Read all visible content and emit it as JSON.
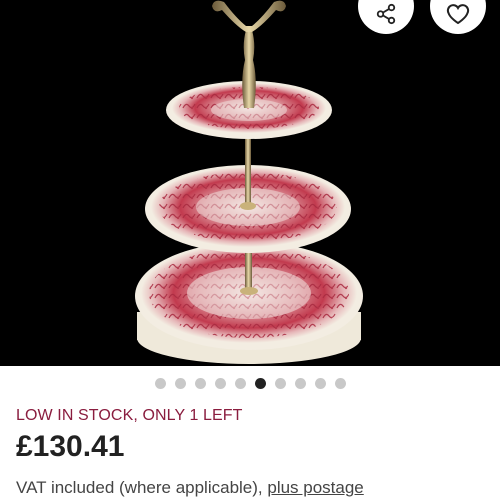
{
  "product": {
    "image_alt": "Three-tier red transferware cake stand",
    "gallery_dots": 10,
    "gallery_active_index": 5,
    "stock_notice": "LOW IN STOCK, ONLY 1 LEFT",
    "price": "£130.41",
    "vat_text": "VAT included (where applicable), ",
    "postage_link": "plus postage"
  },
  "actions": {
    "share_icon": "share-icon",
    "favorite_icon": "heart-icon"
  },
  "colors": {
    "stock_notice": "#8a1d3f",
    "plate_pattern": "#c23a4e",
    "background": "#000000"
  }
}
